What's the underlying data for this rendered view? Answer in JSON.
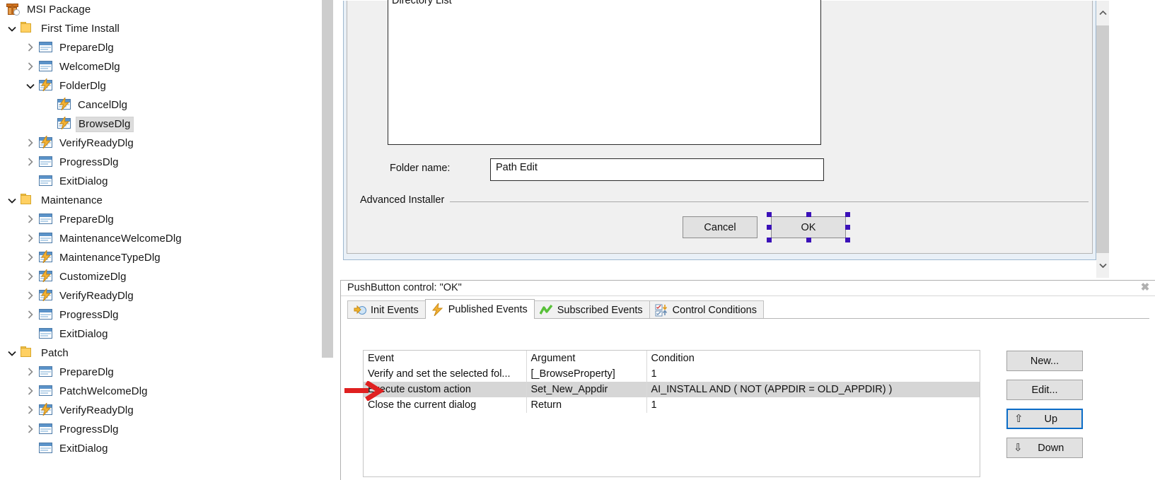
{
  "tree": {
    "root": {
      "label": "MSI Package",
      "icon": "msi-package-icon"
    },
    "items": [
      {
        "label": "First Time Install",
        "icon": "folder-icon",
        "indent": 1,
        "chevron": "expanded"
      },
      {
        "label": "PrepareDlg",
        "icon": "dialog-icon",
        "indent": 2,
        "chevron": "collapsed"
      },
      {
        "label": "WelcomeDlg",
        "icon": "dialog-icon",
        "indent": 2,
        "chevron": "collapsed"
      },
      {
        "label": "FolderDlg",
        "icon": "dialog-event-icon",
        "indent": 2,
        "chevron": "expanded"
      },
      {
        "label": "CancelDlg",
        "icon": "dialog-event-icon",
        "indent": 3,
        "chevron": "none"
      },
      {
        "label": "BrowseDlg",
        "icon": "dialog-event-icon",
        "indent": 3,
        "chevron": "none",
        "selected": true
      },
      {
        "label": "VerifyReadyDlg",
        "icon": "dialog-event-icon",
        "indent": 2,
        "chevron": "collapsed"
      },
      {
        "label": "ProgressDlg",
        "icon": "dialog-icon",
        "indent": 2,
        "chevron": "collapsed"
      },
      {
        "label": "ExitDialog",
        "icon": "dialog-icon",
        "indent": 2,
        "chevron": "none"
      },
      {
        "label": "Maintenance",
        "icon": "folder-icon",
        "indent": 1,
        "chevron": "expanded"
      },
      {
        "label": "PrepareDlg",
        "icon": "dialog-icon",
        "indent": 2,
        "chevron": "collapsed"
      },
      {
        "label": "MaintenanceWelcomeDlg",
        "icon": "dialog-icon",
        "indent": 2,
        "chevron": "collapsed"
      },
      {
        "label": "MaintenanceTypeDlg",
        "icon": "dialog-event-icon",
        "indent": 2,
        "chevron": "collapsed"
      },
      {
        "label": "CustomizeDlg",
        "icon": "dialog-event-icon",
        "indent": 2,
        "chevron": "collapsed"
      },
      {
        "label": "VerifyReadyDlg",
        "icon": "dialog-event-icon",
        "indent": 2,
        "chevron": "collapsed"
      },
      {
        "label": "ProgressDlg",
        "icon": "dialog-icon",
        "indent": 2,
        "chevron": "collapsed"
      },
      {
        "label": "ExitDialog",
        "icon": "dialog-icon",
        "indent": 2,
        "chevron": "none"
      },
      {
        "label": "Patch",
        "icon": "folder-icon",
        "indent": 1,
        "chevron": "expanded"
      },
      {
        "label": "PrepareDlg",
        "icon": "dialog-icon",
        "indent": 2,
        "chevron": "collapsed"
      },
      {
        "label": "PatchWelcomeDlg",
        "icon": "dialog-icon",
        "indent": 2,
        "chevron": "collapsed"
      },
      {
        "label": "VerifyReadyDlg",
        "icon": "dialog-event-icon",
        "indent": 2,
        "chevron": "collapsed"
      },
      {
        "label": "ProgressDlg",
        "icon": "dialog-icon",
        "indent": 2,
        "chevron": "collapsed"
      },
      {
        "label": "ExitDialog",
        "icon": "dialog-icon",
        "indent": 2,
        "chevron": "none"
      }
    ]
  },
  "designer": {
    "directory_list_label": "Directory List",
    "folder_name_label": "Folder name:",
    "path_edit_value": "Path Edit",
    "brand_text": "Advanced Installer",
    "cancel_label": "Cancel",
    "ok_label": "OK",
    "selection_color": "#3b11b8"
  },
  "bottom_panel": {
    "title": "PushButton control: \"OK\"",
    "close_glyph": "✖",
    "tabs": [
      {
        "label": "Init Events",
        "icon": "init-events-icon",
        "active": false
      },
      {
        "label": "Published Events",
        "icon": "published-events-icon",
        "active": true
      },
      {
        "label": "Subscribed Events",
        "icon": "subscribed-events-icon",
        "active": false
      },
      {
        "label": "Control Conditions",
        "icon": "control-conditions-icon",
        "active": false
      }
    ],
    "grid": {
      "columns": [
        "Event",
        "Argument",
        "Condition"
      ],
      "rows": [
        {
          "event": "Verify and set the selected fol...",
          "argument": "[_BrowseProperty]",
          "condition": "1",
          "selected": false
        },
        {
          "event": "Execute custom action",
          "argument": "Set_New_Appdir",
          "condition": "AI_INSTALL AND ( NOT (APPDIR = OLD_APPDIR) )",
          "selected": true
        },
        {
          "event": "Close the current dialog",
          "argument": "Return",
          "condition": "1",
          "selected": false
        }
      ]
    },
    "actions": [
      {
        "label": "New...",
        "icon": "",
        "focused": false
      },
      {
        "label": "Edit...",
        "icon": "",
        "focused": false
      },
      {
        "label": "Up",
        "icon": "arrow-up-icon",
        "glyph": "⇧",
        "focused": true
      },
      {
        "label": "Down",
        "icon": "arrow-down-icon",
        "glyph": "⇩",
        "focused": false
      }
    ]
  },
  "annotation": {
    "arrow_color": "#e02020",
    "points_to": "Execute custom action"
  },
  "scrollbars": {
    "down_chevron": "⌄",
    "up_chevron": "⌃"
  }
}
